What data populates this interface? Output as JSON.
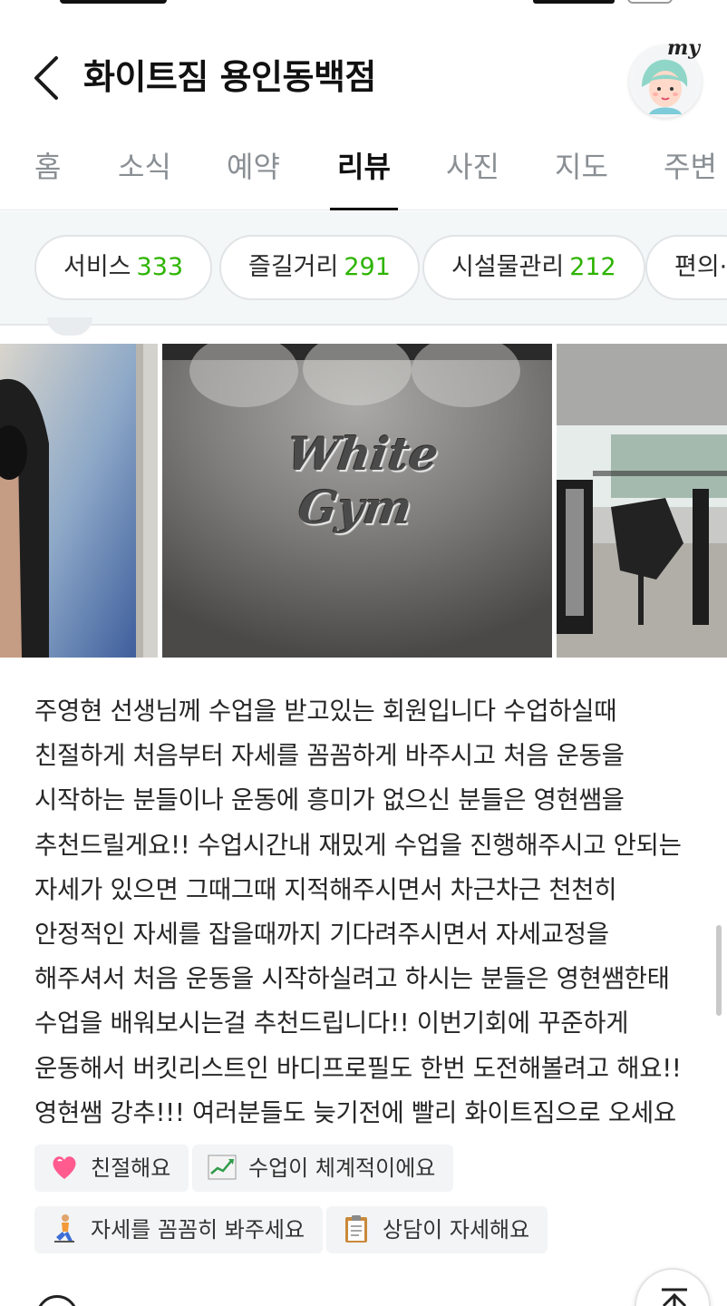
{
  "header": {
    "title": "화이트짐 용인동백점",
    "my_label": "my"
  },
  "tabs": [
    {
      "label": "홈",
      "active": false
    },
    {
      "label": "소식",
      "active": false
    },
    {
      "label": "예약",
      "active": false
    },
    {
      "label": "리뷰",
      "active": true
    },
    {
      "label": "사진",
      "active": false
    },
    {
      "label": "지도",
      "active": false
    },
    {
      "label": "주변",
      "active": false
    }
  ],
  "chips": [
    {
      "label": "서비스",
      "count": "333"
    },
    {
      "label": "즐길거리",
      "count": "291"
    },
    {
      "label": "시설물관리",
      "count": "212"
    },
    {
      "label": "편의·",
      "count": ""
    }
  ],
  "photos": {
    "sign_text": "White Gym"
  },
  "review": {
    "text": "주영현 선생님께 수업을 받고있는 회원입니다 수업하실때 친절하게 처음부터 자세를 꼼꼼하게 바주시고 처음 운동을 시작하는 분들이나 운동에 흥미가 없으신 분들은 영현쌤을 추천드릴게요!! 수업시간내 재밌게 수업을 진행해주시고 안되는 자세가 있으면 그때그때 지적해주시면서 차근차근 천천히 안정적인 자세를 잡을때까지 기다려주시면서 자세교정을 해주셔서 처음 운동을 시작하실려고 하시는 분들은 영현쌤한태 수업을 배워보시는걸 추천드립니다!! 이번기회에 꾸준하게 운동해서 버킷리스트인 바디프로필도 한번 도전해볼려고 해요!! 영현쌤 강추!!! 여러분들도 늦기전에 빨리 화이트짐으로 오세요"
  },
  "tags": [
    {
      "label": "친절해요",
      "icon": "heart-icon"
    },
    {
      "label": "수업이 체계적이에요",
      "icon": "chart-increasing-icon"
    },
    {
      "label": "자세를 꼼꼼히 봐주세요",
      "icon": "kneeling-person-icon"
    },
    {
      "label": "상담이 자세해요",
      "icon": "clipboard-icon"
    }
  ],
  "colors": {
    "accent_count": "#2db400",
    "chip_bar_bg": "#f4f7f8",
    "tag_bg": "#f2f4f5"
  }
}
